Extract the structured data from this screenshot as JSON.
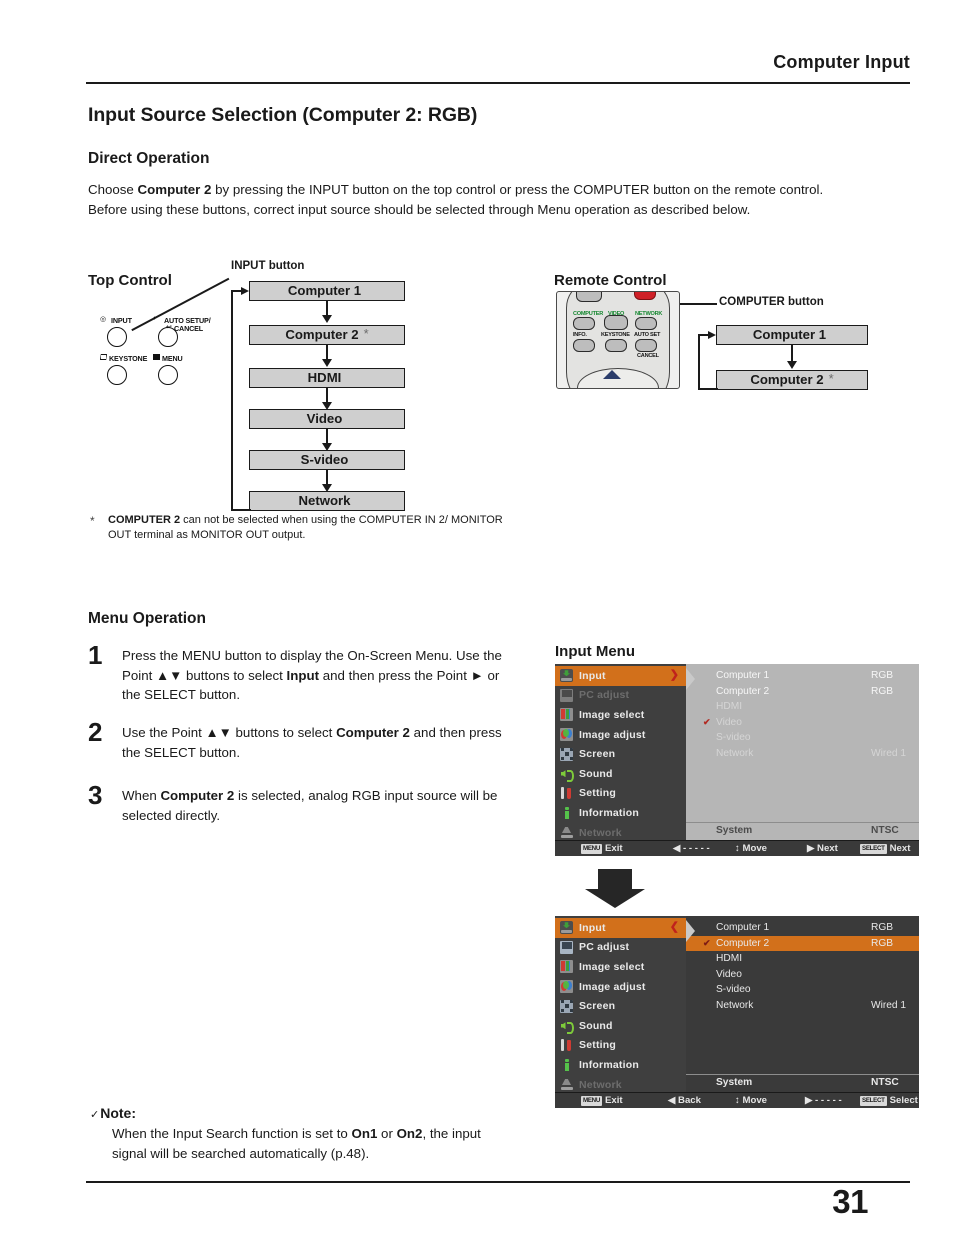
{
  "header": {
    "title": "Computer Input"
  },
  "page": {
    "number": "31"
  },
  "section": {
    "title": "Input Source Selection (Computer 2: RGB)",
    "direct_operation_heading": "Direct Operation",
    "menu_operation_heading": "Menu Operation",
    "intro_line1_a": "Choose ",
    "intro_line1_b": "Computer 2",
    "intro_line1_c": " by pressing the INPUT button on the top control or press the COMPUTER button on the remote control.",
    "intro_line2": "Before using these buttons, correct input source should be selected through Menu operation as described below."
  },
  "top_control": {
    "label": "Top Control",
    "input_button_callout": "INPUT button",
    "keys": [
      {
        "caption": "INPUT",
        "glyph": "input-key-icon"
      },
      {
        "caption": "AUTO SETUP/",
        "caption2": "CANCEL",
        "glyph": "auto-setup-key-icon"
      },
      {
        "caption": "KEYSTONE",
        "glyph": "keystone-key-icon"
      },
      {
        "caption": "MENU",
        "glyph": "menu-key-icon"
      }
    ],
    "flow": [
      {
        "label": "Computer 1",
        "asterisk": ""
      },
      {
        "label": "Computer 2",
        "asterisk": "*"
      },
      {
        "label": "HDMI",
        "asterisk": ""
      },
      {
        "label": "Video",
        "asterisk": ""
      },
      {
        "label": "S-video",
        "asterisk": ""
      },
      {
        "label": "Network",
        "asterisk": ""
      }
    ]
  },
  "remote_control": {
    "label": "Remote Control",
    "computer_button_callout": "COMPUTER button",
    "buttons": [
      {
        "label": "COMPUTER"
      },
      {
        "label": "VIDEO"
      },
      {
        "label": "NETWORK"
      },
      {
        "label": "INFO."
      },
      {
        "label": "KEYSTONE"
      },
      {
        "label": "AUTO SET"
      },
      {
        "label": "CANCEL"
      }
    ],
    "flow": [
      {
        "label": "Computer 1",
        "asterisk": ""
      },
      {
        "label": "Computer 2",
        "asterisk": "*"
      }
    ]
  },
  "footnote": {
    "star": "*",
    "bold": "COMPUTER 2",
    "text": " can not be selected when using the COMPUTER IN 2/ MONITOR OUT terminal as MONITOR OUT output."
  },
  "steps": [
    {
      "number": "1",
      "parts": [
        {
          "t": "Press the MENU button to display the On-Screen Menu. Use the Point ▲▼ buttons to select ",
          "b": false
        },
        {
          "t": "Input",
          "b": true
        },
        {
          "t": " and then press the Point ► or the SELECT button.",
          "b": false
        }
      ]
    },
    {
      "number": "2",
      "parts": [
        {
          "t": "Use the Point ▲▼ buttons to select ",
          "b": false
        },
        {
          "t": "Computer 2",
          "b": true
        },
        {
          "t": " and then press the SELECT button.",
          "b": false
        }
      ]
    },
    {
      "number": "3",
      "parts": [
        {
          "t": "When ",
          "b": false
        },
        {
          "t": "Computer 2",
          "b": true
        },
        {
          "t": " is selected, analog RGB input source will be selected directly.",
          "b": false
        }
      ]
    }
  ],
  "note": {
    "check": "✓",
    "heading": "Note:",
    "parts": [
      {
        "t": "When the Input Search function is set to ",
        "b": false
      },
      {
        "t": "On1",
        "b": true
      },
      {
        "t": " or ",
        "b": false
      },
      {
        "t": "On2",
        "b": true
      },
      {
        "t": ", the input signal will be searched automatically (p.48).",
        "b": false
      }
    ]
  },
  "input_menu": {
    "label": "Input Menu",
    "sidebar": [
      {
        "label": "Input",
        "icon": "input-menu-icon",
        "state": "selected"
      },
      {
        "label": "PC adjust",
        "icon": "pc-adjust-icon",
        "state": "disabled"
      },
      {
        "label": "Image select",
        "icon": "image-select-icon",
        "state": "normal"
      },
      {
        "label": "Image adjust",
        "icon": "image-adjust-icon",
        "state": "normal"
      },
      {
        "label": "Screen",
        "icon": "screen-icon",
        "state": "normal"
      },
      {
        "label": "Sound",
        "icon": "sound-icon",
        "state": "normal"
      },
      {
        "label": "Setting",
        "icon": "setting-icon",
        "state": "normal"
      },
      {
        "label": "Information",
        "icon": "information-icon",
        "state": "normal"
      },
      {
        "label": "Network",
        "icon": "network-icon",
        "state": "disabled"
      }
    ],
    "screen_a": {
      "caret": "❯",
      "rows": [
        {
          "name": "Computer 1",
          "value": "RGB",
          "checked": false,
          "selected": false
        },
        {
          "name": "Computer 2",
          "value": "RGB",
          "checked": false,
          "selected": false
        },
        {
          "name": "HDMI",
          "value": "",
          "checked": false,
          "selected": false
        },
        {
          "name": "Video",
          "value": "",
          "checked": true,
          "selected": false
        },
        {
          "name": "S-video",
          "value": "",
          "checked": false,
          "selected": false
        },
        {
          "name": "Network",
          "value": "Wired 1",
          "checked": false,
          "selected": false
        }
      ],
      "system_label": "System",
      "system_value": "NTSC",
      "bar": [
        {
          "chip": "MENU",
          "text": "Exit"
        },
        {
          "chip": "",
          "text": "◀ - - - - -"
        },
        {
          "chip": "",
          "text": "↕ Move"
        },
        {
          "chip": "",
          "text": "▶ Next"
        },
        {
          "chip": "SELECT",
          "text": "Next"
        }
      ]
    },
    "screen_b": {
      "caret": "❮",
      "rows": [
        {
          "name": "Computer 1",
          "value": "RGB",
          "checked": false,
          "selected": false
        },
        {
          "name": "Computer 2",
          "value": "RGB",
          "checked": true,
          "selected": true
        },
        {
          "name": "HDMI",
          "value": "",
          "checked": false,
          "selected": false
        },
        {
          "name": "Video",
          "value": "",
          "checked": false,
          "selected": false
        },
        {
          "name": "S-video",
          "value": "",
          "checked": false,
          "selected": false
        },
        {
          "name": "Network",
          "value": "Wired 1",
          "checked": false,
          "selected": false
        }
      ],
      "system_label": "System",
      "system_value": "NTSC",
      "bar": [
        {
          "chip": "MENU",
          "text": "Exit"
        },
        {
          "chip": "",
          "text": "◀ Back"
        },
        {
          "chip": "",
          "text": "↕ Move"
        },
        {
          "chip": "",
          "text": "▶ - - - - -"
        },
        {
          "chip": "SELECT",
          "text": "Select"
        }
      ]
    }
  },
  "colors": {
    "accent_orange": "#d2701b",
    "osd_dark": "#3a3a3a",
    "osd_light_panel": "#b6b6b6",
    "flow_box_gray": "#cfcfcf",
    "red_caret": "#c0221c"
  }
}
